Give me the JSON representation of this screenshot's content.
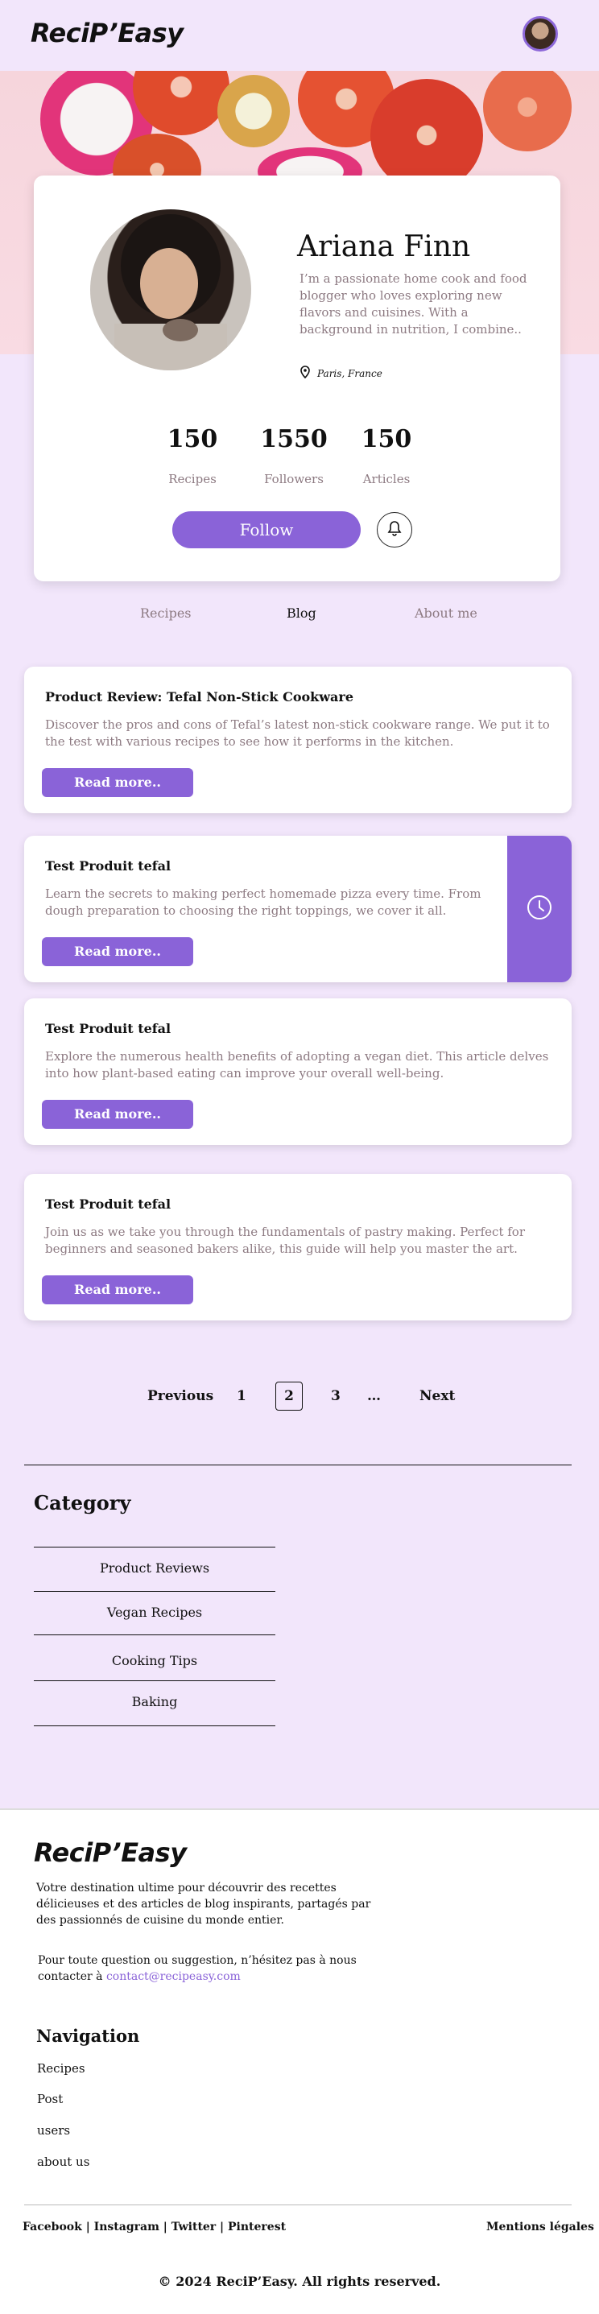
{
  "header": {
    "logo": "ReciP’Easy",
    "avatar": "user-avatar"
  },
  "profile": {
    "name": "Ariana Finn",
    "bio": "I’m a passionate home cook and food blogger who loves exploring new flavors and cuisines. With a background in nutrition, I combine..",
    "location": "Paris, France",
    "stats": [
      {
        "value": "150",
        "label": "Recipes"
      },
      {
        "value": "1550",
        "label": "Followers"
      },
      {
        "value": "150",
        "label": "Articles"
      }
    ],
    "follow_label": "Follow"
  },
  "tabs": [
    {
      "label": "Recipes",
      "active": false
    },
    {
      "label": "Blog",
      "active": true
    },
    {
      "label": "About me",
      "active": false
    }
  ],
  "articles": [
    {
      "title": "Product Review: Tefal Non-Stick Cookware",
      "text": "Discover the pros and cons of Tefal’s latest non-stick cookware range. We put it to the test with various recipes to see how it performs in the kitchen.",
      "button": "Read more.."
    },
    {
      "title": "Test Produit tefal",
      "text": "Learn the secrets to making perfect homemade pizza every time. From dough preparation to choosing the right toppings, we cover it all.",
      "button": "Read more.."
    },
    {
      "title": "Test Produit tefal",
      "text": "Explore the numerous health benefits of adopting a vegan diet. This article delves into how plant-based eating can improve your overall well-being.",
      "button": "Read more.."
    },
    {
      "title": "Test Produit tefal",
      "text": "Join us as we take you through the fundamentals of pastry making. Perfect for beginners and seasoned bakers alike, this guide will help you master the art.",
      "button": "Read more.."
    }
  ],
  "pagination": {
    "previous": "Previous",
    "pages": [
      "1",
      "2",
      "3"
    ],
    "ellipsis": "…",
    "next": "Next",
    "current": "2"
  },
  "category": {
    "title": "Category",
    "items": [
      "Product Reviews",
      "Vegan Recipes",
      "Cooking Tips",
      "Baking"
    ]
  },
  "footer": {
    "logo": "ReciP’Easy",
    "description": "Votre destination ultime pour découvrir des recettes délicieuses et des articles de blog inspirants, partagés par des passionnés de cuisine du monde entier.",
    "contact_prefix": "Pour toute question ou suggestion, n’hésitez pas à nous contacter à ",
    "contact_email": "contact@recipeasy.com",
    "nav_title": "Navigation",
    "nav_links": [
      "Recipes",
      "Post",
      "users",
      "about us"
    ],
    "social": "Facebook | Instagram | Twitter | Pinterest",
    "legal": "Mentions légales",
    "copyright": "© 2024 ReciP’Easy. All rights reserved."
  },
  "colors": {
    "accent": "#8a63d8",
    "background": "#f2e6fb",
    "muted_text": "#8d7a82"
  }
}
